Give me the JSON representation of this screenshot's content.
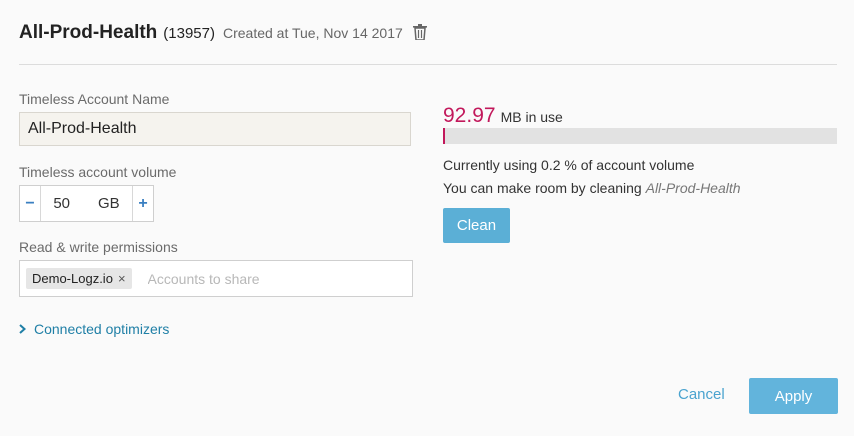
{
  "header": {
    "title": "All-Prod-Health",
    "account_id": "(13957)",
    "created": "Created at Tue, Nov 14 2017",
    "trash_icon": "trash-icon"
  },
  "form": {
    "name_label": "Timeless Account Name",
    "name_value": "All-Prod-Health",
    "volume_label": "Timeless account volume",
    "volume_value": "50",
    "volume_unit": "GB",
    "minus_symbol": "−",
    "plus_symbol": "+",
    "permissions_label": "Read & write permissions",
    "chips": [
      {
        "label": "Demo-Logz.io",
        "remove": "×"
      }
    ],
    "share_placeholder": "Accounts to share",
    "optimizers_label": "Connected optimizers",
    "optimizers_icon": "chevron-right-icon"
  },
  "usage": {
    "amount": "92.97",
    "unit": "MB in use",
    "percent_used": 0.2,
    "line1": "Currently using 0.2 % of account volume",
    "line2_prefix": "You can make room by cleaning ",
    "line2_account": "All-Prod-Health",
    "clean_label": "Clean"
  },
  "footer": {
    "cancel_label": "Cancel",
    "apply_label": "Apply"
  },
  "colors": {
    "accent": "#c2185b",
    "primary_button": "#5bafd6",
    "link": "#1f7fa6"
  }
}
